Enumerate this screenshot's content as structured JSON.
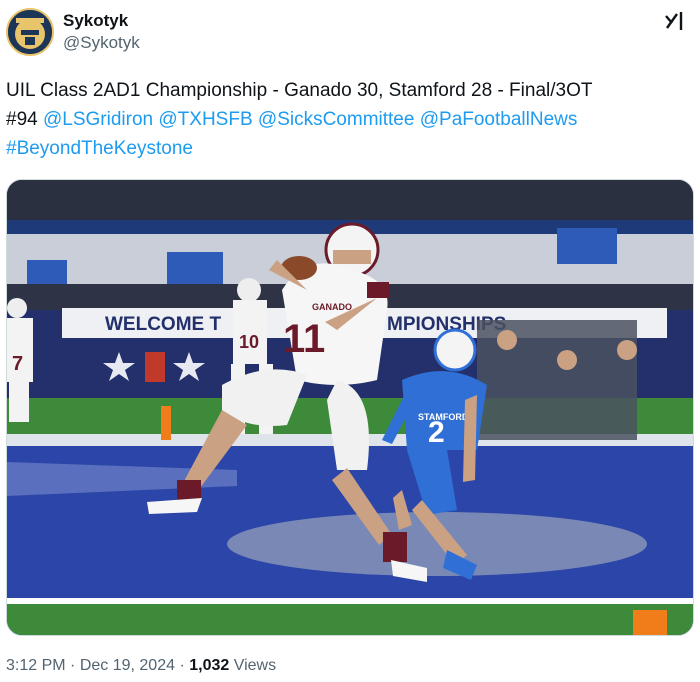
{
  "user": {
    "display_name": "Sykotyk",
    "handle": "@Sykotyk",
    "avatar_icon": "helmet-avatar-icon"
  },
  "grok_icon": "grok-icon",
  "tweet": {
    "text_line1": "UIL Class 2AD1 Championship - Ganado 30, Stamford 28 - Final/3OT",
    "tag_94": "#94",
    "mentions": [
      "@LSGridiron",
      "@TXHSFB",
      "@SicksCommittee",
      "@PaFootballNews"
    ],
    "hashtag": "#BeyondTheKeystone"
  },
  "media": {
    "banner_text": "WELCOME T",
    "banner_text2": "MPIONSHIPS",
    "player1_number": "11",
    "player1_team": "GANADO",
    "player2_number": "2",
    "player2_team": "STAMFORD",
    "bg_player_number": "10",
    "left_player_number": "7",
    "colors": {
      "field_blue": "#2b46a8",
      "turf_green": "#3d8a3a",
      "ganado_maroon": "#6b1a2a",
      "stamford_blue": "#2f6fd6"
    }
  },
  "meta": {
    "time": "3:12 PM",
    "sep1": " · ",
    "date": "Dec 19, 2024",
    "sep2": " · ",
    "views_count": "1,032",
    "views_label": " Views"
  }
}
